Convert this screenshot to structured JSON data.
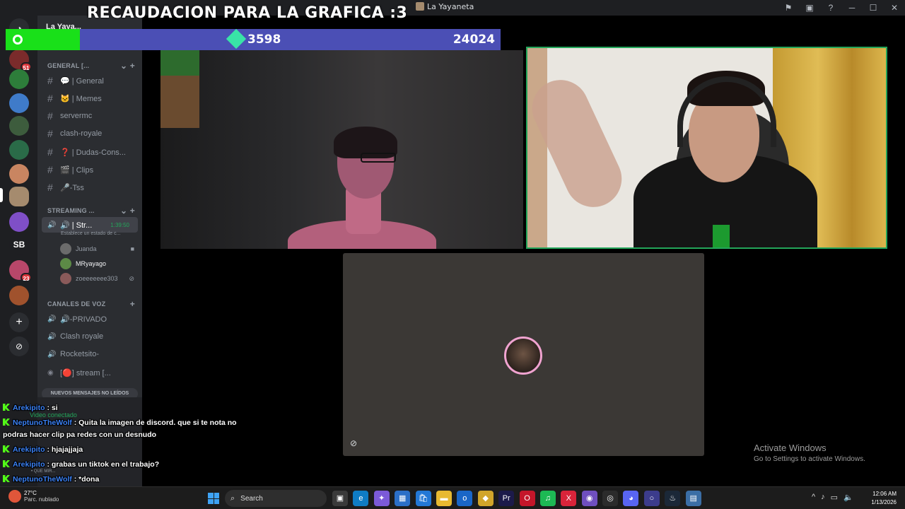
{
  "window": {
    "title": "La Yayaneta"
  },
  "overlay": {
    "title": "RECAUDACION PARA LA GRAFICA :3",
    "goal_current": "3598",
    "goal_target": "24024",
    "goal_progress": 0.15
  },
  "servers": {
    "badges": [
      "51",
      "23"
    ]
  },
  "sidebar": {
    "guild_name": "La Yaya...",
    "categories": {
      "general": "GENERAL [...",
      "streaming": "STREAMING ...",
      "voice": "CANALES DE VOZ"
    },
    "text_channels": [
      {
        "label": "💬 | General"
      },
      {
        "label": "🐱 | Memes"
      },
      {
        "label": "servermc"
      },
      {
        "label": "clash-royale"
      },
      {
        "label": "❓ | Dudas-Cons..."
      },
      {
        "label": "🎬 | Clips"
      },
      {
        "label": "🎤-Tss"
      }
    ],
    "active_voice": {
      "label": "🔊 | Str...",
      "timer": "1:39:50",
      "status": "Establece un estado de c..."
    },
    "members": [
      {
        "name": "Juanda",
        "color": "#6b6b6b"
      },
      {
        "name": "MRyayago",
        "color": "#5c8a46"
      },
      {
        "name": "zoeeeeeee303",
        "color": "#8a5a5a"
      }
    ],
    "voice_channels": [
      {
        "label": "🔊-PRIVADO"
      },
      {
        "label": "Clash royale"
      },
      {
        "label": "Rocketsito-"
      },
      {
        "label": "[🔴] stream [..."
      }
    ],
    "unread": "NUEVOS MENSAJES NO LEÍDOS",
    "voice_status": "Video conectado",
    "panel_user": "• QUE MIR..."
  },
  "chat": [
    {
      "user": "Arekipito",
      "text": ": si"
    },
    {
      "user": "NeptunoTheWolf",
      "text": ": Quita la imagen de discord. que si te nota no podras hacer clip pa redes con un desnudo"
    },
    {
      "user": "Arekipito",
      "text": ": hjajajjaja"
    },
    {
      "user": "Arekipito",
      "text": ": grabas un tiktok en el trabajo?"
    },
    {
      "user": "NeptunoTheWolf",
      "text": ": *dona"
    }
  ],
  "watermark": {
    "line1": "Activate Windows",
    "line2": "Go to Settings to activate Windows."
  },
  "taskbar": {
    "weather_temp": "27°C",
    "weather_desc": "Parc. nublado",
    "search_placeholder": "Search",
    "time": "12:06 AM",
    "date": "1/13/2026",
    "apps": [
      {
        "icon": "task-view-icon",
        "color": "#3a3a3a",
        "glyph": "▣"
      },
      {
        "icon": "edge-icon",
        "color": "#0f7cc4",
        "glyph": "e"
      },
      {
        "icon": "copilot-icon",
        "color": "#7b5ad8",
        "glyph": "✦"
      },
      {
        "icon": "calendar-icon",
        "color": "#2b6fc7",
        "glyph": "▦"
      },
      {
        "icon": "store-icon",
        "color": "#2378d6",
        "glyph": "🛍"
      },
      {
        "icon": "folder-icon",
        "color": "#e8b931",
        "glyph": "▬"
      },
      {
        "icon": "outlook-icon",
        "color": "#1a66c7",
        "glyph": "o"
      },
      {
        "icon": "layers-icon",
        "color": "#d1a52a",
        "glyph": "◆"
      },
      {
        "icon": "premiere-icon",
        "color": "#1c1a4a",
        "glyph": "Pr"
      },
      {
        "icon": "opera-icon",
        "color": "#c4162a",
        "glyph": "O"
      },
      {
        "icon": "spotify-icon",
        "color": "#1db954",
        "glyph": "♫"
      },
      {
        "icon": "xmind-icon",
        "color": "#d8243a",
        "glyph": "X"
      },
      {
        "icon": "game-icon",
        "color": "#6f4fbf",
        "glyph": "◉"
      },
      {
        "icon": "obs-icon",
        "color": "#2b2b2b",
        "glyph": "◎"
      },
      {
        "icon": "discord-icon",
        "color": "#5865f2",
        "glyph": "◕"
      },
      {
        "icon": "circle-app-icon",
        "color": "#3c3c8c",
        "glyph": "○"
      },
      {
        "icon": "steam-icon",
        "color": "#1b2838",
        "glyph": "♨"
      },
      {
        "icon": "calculator-icon",
        "color": "#3b6ea5",
        "glyph": "▤"
      }
    ]
  }
}
